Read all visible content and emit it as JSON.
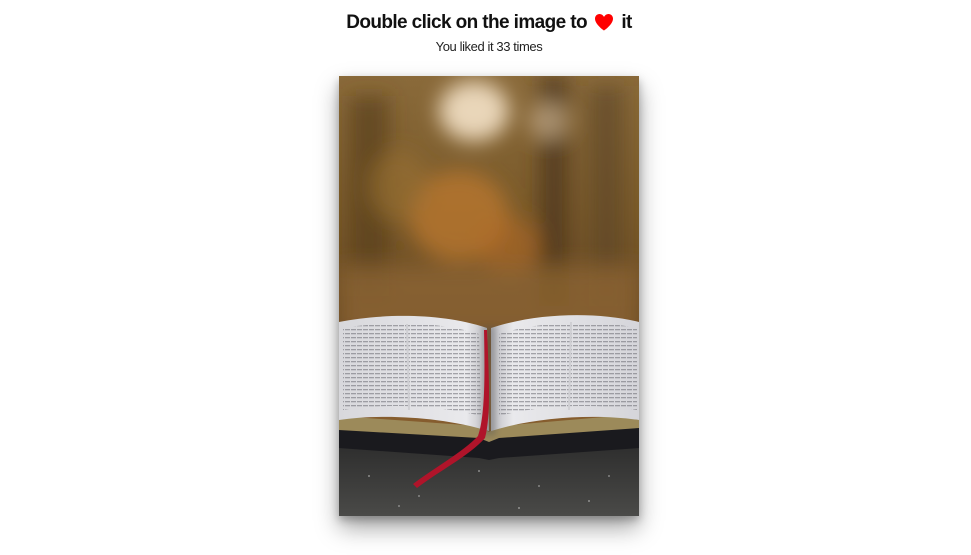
{
  "header": {
    "prefix": "Double click on the image to",
    "suffix": "it",
    "heart_icon": "heart-icon",
    "heart_color": "#ff0000"
  },
  "likes": {
    "text": "You liked it 33 times",
    "count": 33
  },
  "photo": {
    "subject": "open-book-photo"
  }
}
